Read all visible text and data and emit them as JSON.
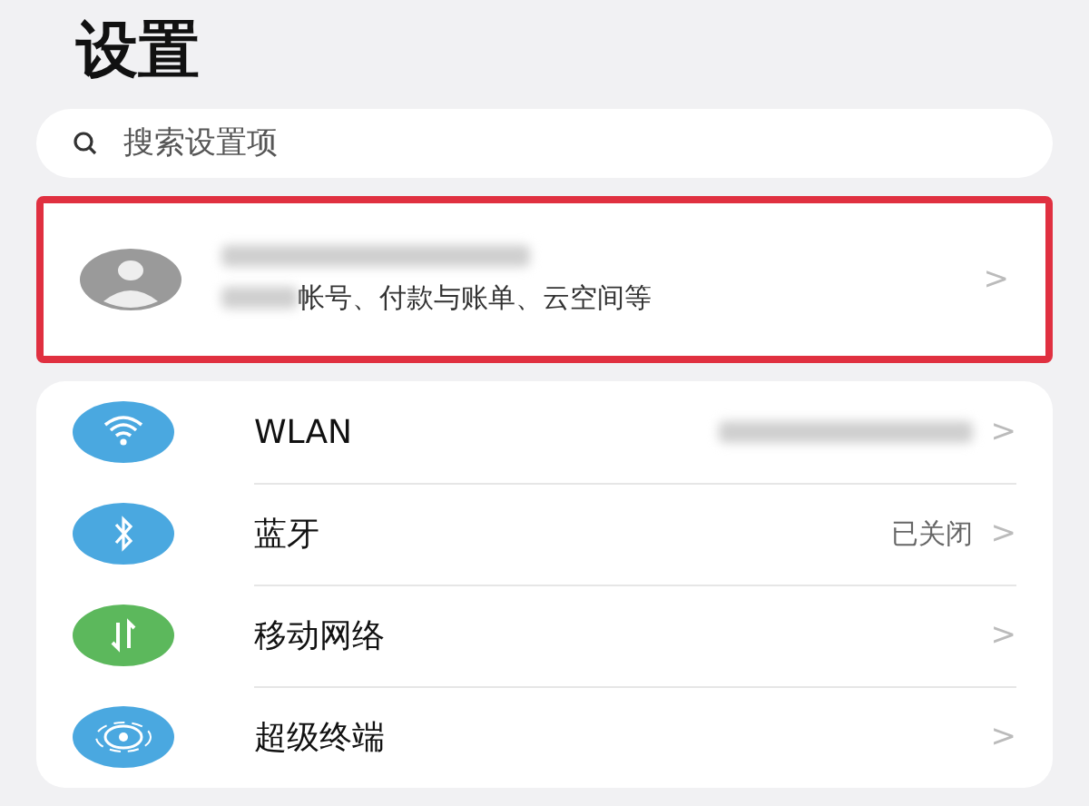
{
  "title": "设置",
  "search": {
    "placeholder": "搜索设置项"
  },
  "account": {
    "highlighted": true,
    "subtitle": "帐号、付款与账单、云空间等",
    "chevron": ">"
  },
  "items": [
    {
      "kind": "wifi",
      "color": "#4aa8e0",
      "label": "WLAN",
      "status_hidden": true,
      "chevron": ">"
    },
    {
      "kind": "bluetooth",
      "color": "#4aa8e0",
      "label": "蓝牙",
      "status": "已关闭",
      "status_hidden": false,
      "chevron": ">"
    },
    {
      "kind": "mobile",
      "color": "#5cb85c",
      "label": "移动网络",
      "status_hidden": false,
      "chevron": ">"
    },
    {
      "kind": "superdevice",
      "color": "#4aa8e0",
      "label": "超级终端",
      "status_hidden": false,
      "chevron": ">"
    }
  ]
}
